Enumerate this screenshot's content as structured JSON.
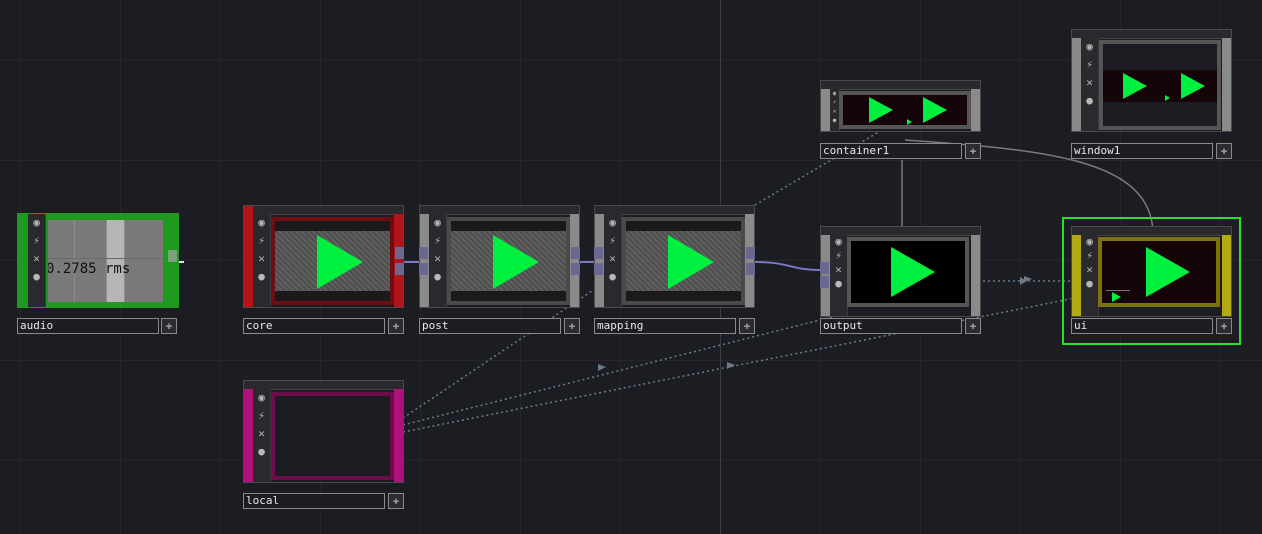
{
  "nodes": {
    "audio": {
      "label": "audio",
      "value_text": "0.2785 rms",
      "color": "#1e9b1e"
    },
    "core": {
      "label": "core",
      "color": "#b3141a"
    },
    "post": {
      "label": "post",
      "color": "#888888"
    },
    "mapping": {
      "label": "mapping",
      "color": "#888888"
    },
    "output": {
      "label": "output",
      "color": "#888888"
    },
    "container1": {
      "label": "container1",
      "color": "#888888"
    },
    "window1": {
      "label": "window1",
      "color": "#888888"
    },
    "ui": {
      "label": "ui",
      "color": "#b3aa14",
      "selected_border": "#27e027"
    },
    "local": {
      "label": "local",
      "color": "#b0127a"
    }
  },
  "icons": {
    "viewer": "◉",
    "cook": "⚡",
    "bypass": "✕",
    "lock": "🔒",
    "add": "✚"
  },
  "colors": {
    "play_green": "#00f040",
    "wire_solid": "#7b78c8",
    "wire_dotted": "#6c7a88"
  }
}
